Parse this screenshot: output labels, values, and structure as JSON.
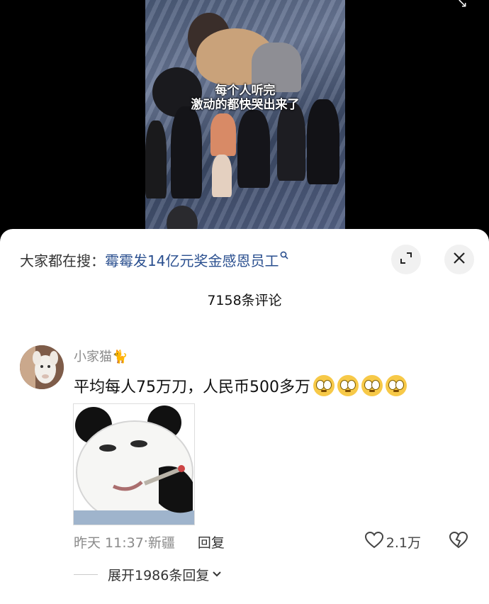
{
  "video": {
    "caption_line1": "每个人听完",
    "caption_line2": "激动的都快哭出来了"
  },
  "search": {
    "prefix": "大家都在搜：",
    "term": "霉霉发14亿元奖金感恩员工",
    "icon": "search-icon"
  },
  "buttons": {
    "collapse_icon": "collapse-icon",
    "close_icon": "close-icon"
  },
  "comments_header": {
    "count_label": "7158条评论"
  },
  "comment": {
    "username": "小家猫🐈",
    "text": "平均每人75万刀，人民币500多万",
    "emoji_count": 4,
    "emoji_name": "flushed-face-emoji",
    "time": "昨天 11:37",
    "location_sep": "·",
    "location": "新疆",
    "reply_label": "回复",
    "likes": "2.1万",
    "expand_label": "展开1986条回复"
  },
  "colors": {
    "link_blue": "#2a4f8f",
    "meta_gray": "#8a8a8a",
    "sheet_bg": "#ffffff"
  }
}
